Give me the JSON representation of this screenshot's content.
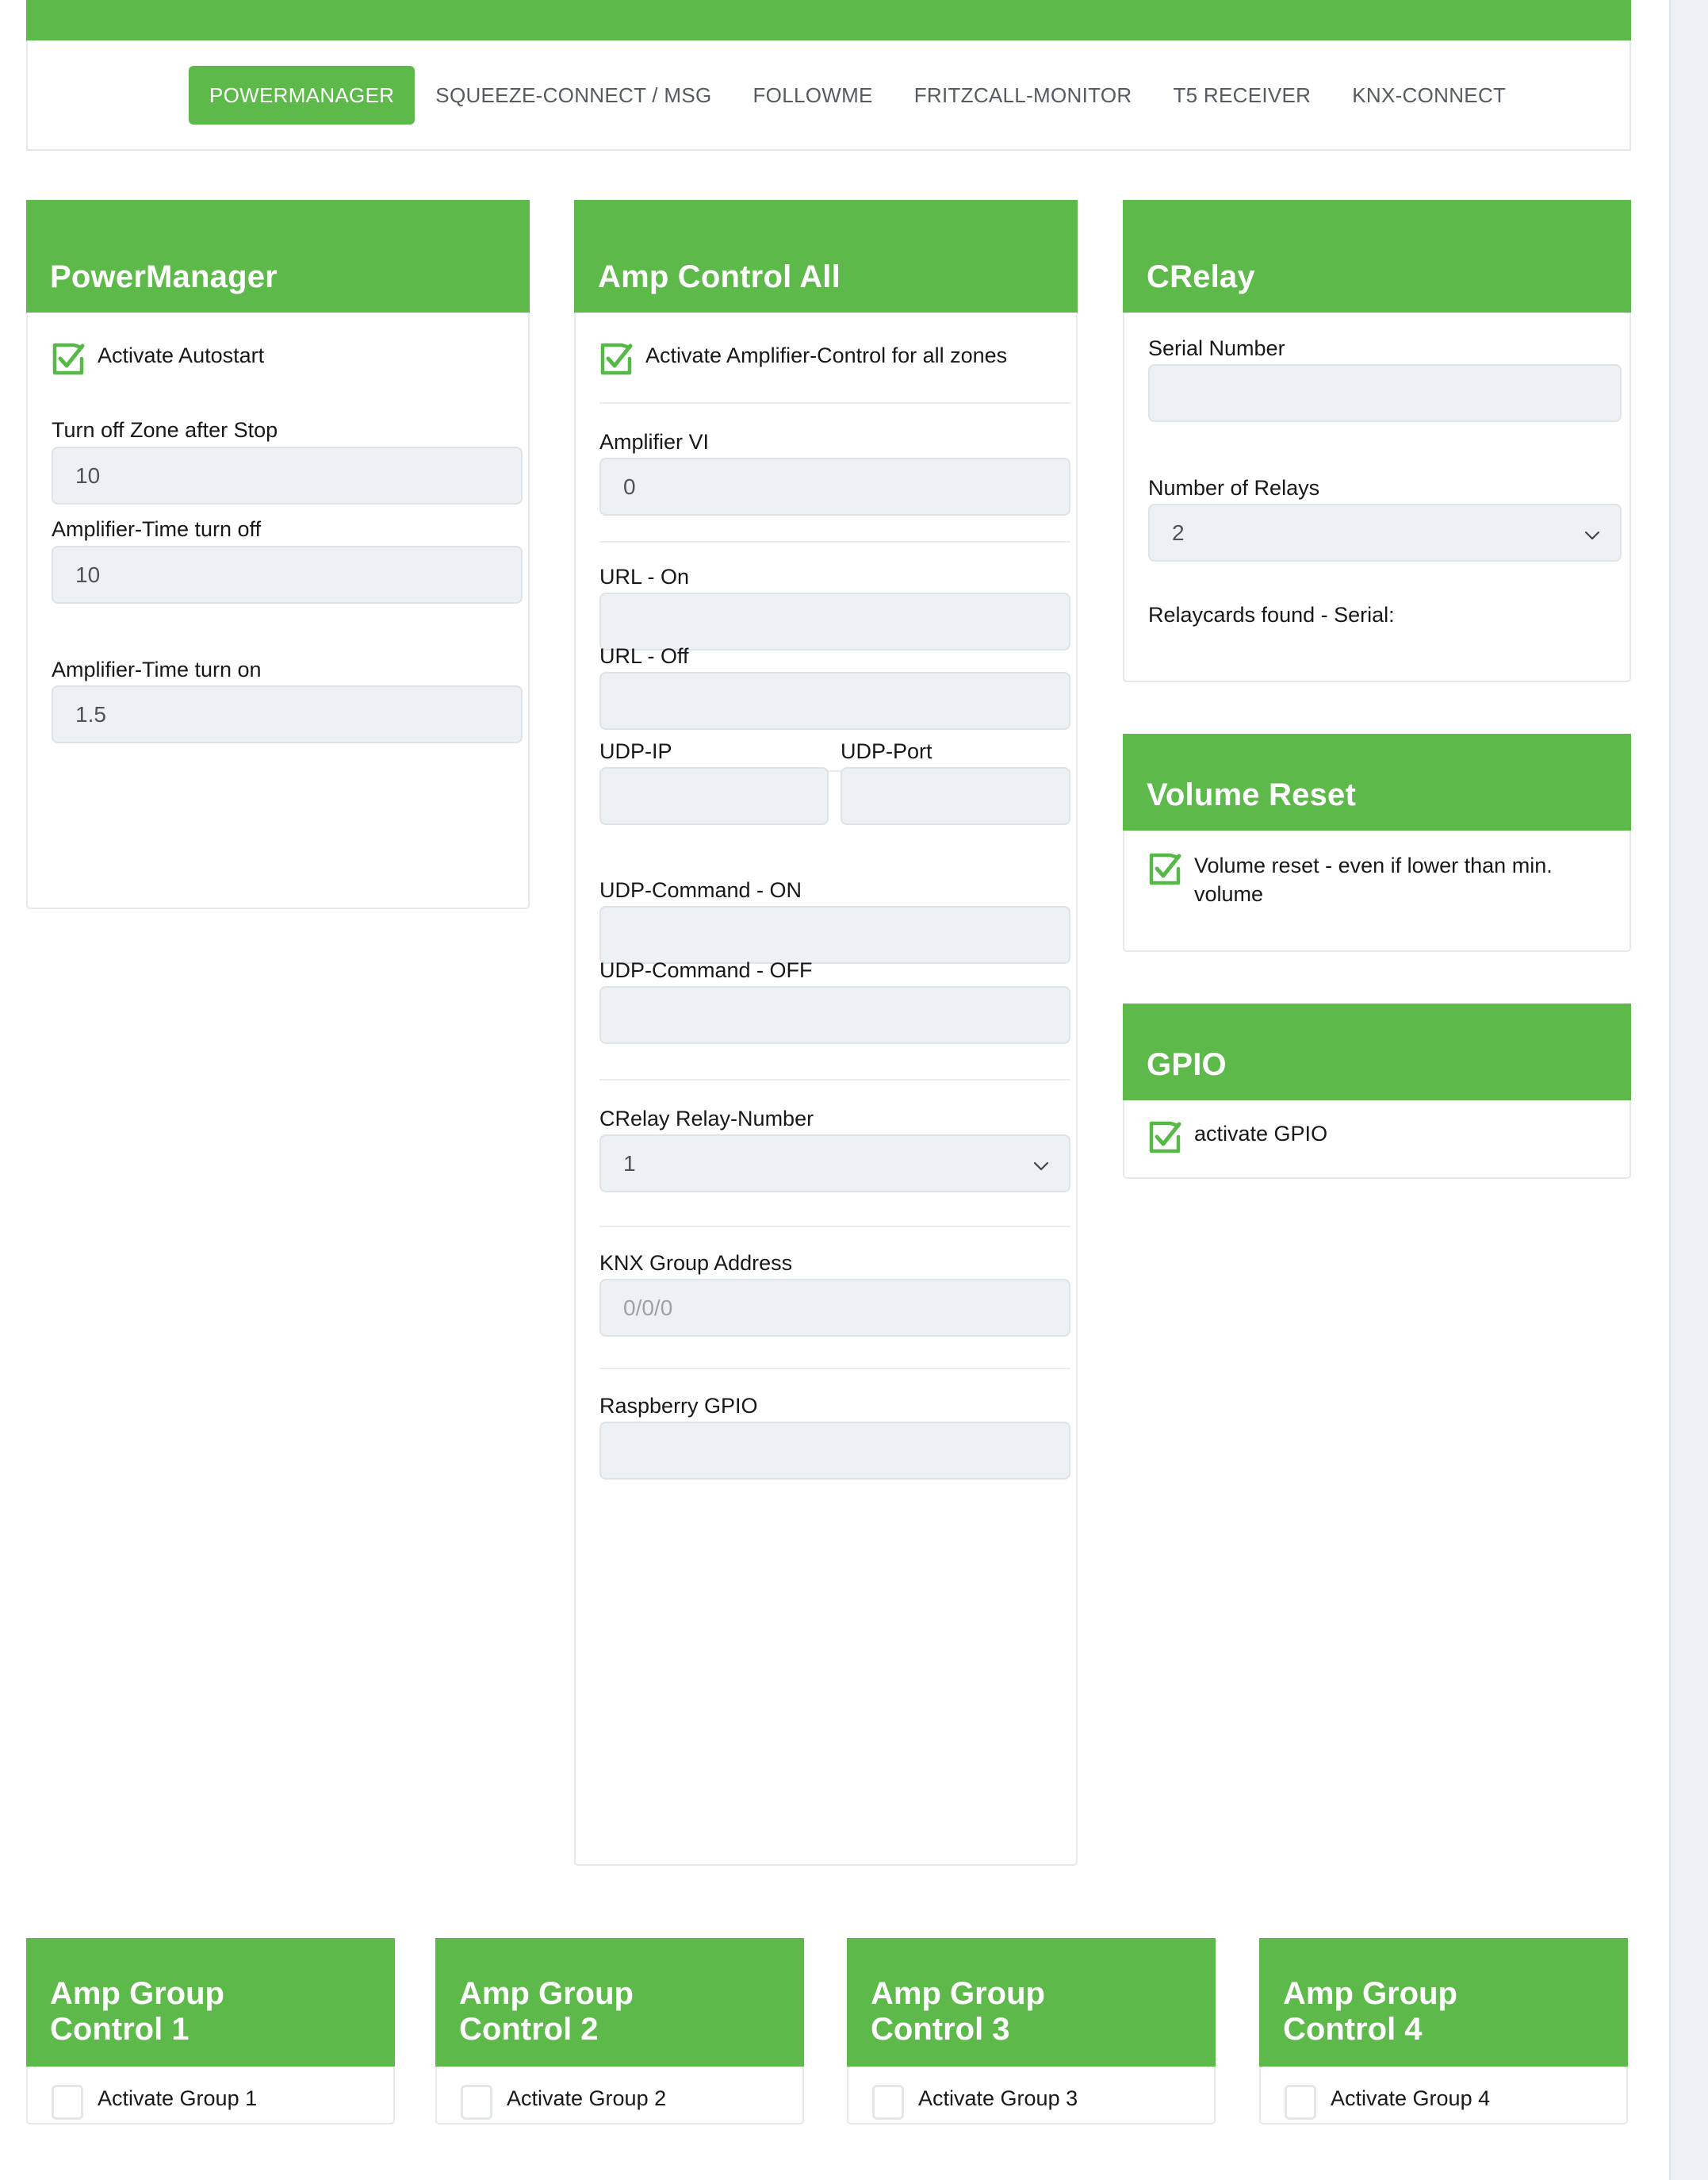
{
  "nav": {
    "tabs": [
      {
        "label": "POWERMANAGER",
        "active": true
      },
      {
        "label": "SQUEEZE-CONNECT / MSG",
        "active": false
      },
      {
        "label": "FOLLOWME",
        "active": false
      },
      {
        "label": "FRITZCALL-MONITOR",
        "active": false
      },
      {
        "label": "T5 RECEIVER",
        "active": false
      },
      {
        "label": "KNX-CONNECT",
        "active": false
      }
    ]
  },
  "colors": {
    "brand_green": "#5cb94a",
    "input_bg": "#edf1f4",
    "card_border": "#e6e8ea",
    "gutter": "#eef1f4"
  },
  "power_manager": {
    "title": "PowerManager",
    "autostart_label": "Activate Autostart",
    "autostart_checked": true,
    "turn_off_zone_label": "Turn off Zone after Stop",
    "turn_off_zone_value": "10",
    "amp_time_off_label": "Amplifier-Time turn off",
    "amp_time_off_value": "10",
    "amp_time_on_label": "Amplifier-Time turn on",
    "amp_time_on_value": "1.5"
  },
  "amp_control_all": {
    "title": "Amp Control All",
    "activate_label": "Activate Amplifier-Control for all zones",
    "activate_checked": true,
    "amplifier_vi_label": "Amplifier VI",
    "amplifier_vi_value": "0",
    "url_on_label": "URL - On",
    "url_on_value": "",
    "url_off_label": "URL - Off",
    "url_off_value": "",
    "udp_ip_label": "UDP-IP",
    "udp_ip_value": "",
    "udp_port_label": "UDP-Port",
    "udp_port_value": "",
    "udp_cmd_on_label": "UDP-Command - ON",
    "udp_cmd_on_value": "",
    "udp_cmd_off_label": "UDP-Command - OFF",
    "udp_cmd_off_value": "",
    "crelay_relay_number_label": "CRelay Relay-Number",
    "crelay_relay_number_value": "1",
    "knx_group_address_label": "KNX Group Address",
    "knx_group_address_placeholder": "0/0/0",
    "raspberry_gpio_label": "Raspberry GPIO",
    "raspberry_gpio_value": ""
  },
  "crelay": {
    "title": "CRelay",
    "serial_number_label": "Serial Number",
    "serial_number_value": "",
    "number_of_relays_label": "Number of Relays",
    "number_of_relays_value": "2",
    "relaycards_found_label": "Relaycards found - Serial:"
  },
  "volume_reset": {
    "title": "Volume Reset",
    "checkbox_label": "Volume reset - even if lower than min. volume",
    "checked": true
  },
  "gpio": {
    "title": "GPIO",
    "checkbox_label": "activate GPIO",
    "checked": true
  },
  "amp_groups": [
    {
      "title_line1": "Amp Group",
      "title_line2": "Control 1",
      "checkbox_label": "Activate Group 1",
      "checked": false
    },
    {
      "title_line1": "Amp Group",
      "title_line2": "Control 2",
      "checkbox_label": "Activate Group 2",
      "checked": false
    },
    {
      "title_line1": "Amp Group",
      "title_line2": "Control 3",
      "checkbox_label": "Activate Group 3",
      "checked": false
    },
    {
      "title_line1": "Amp Group",
      "title_line2": "Control 4",
      "checkbox_label": "Activate Group 4",
      "checked": false
    }
  ]
}
